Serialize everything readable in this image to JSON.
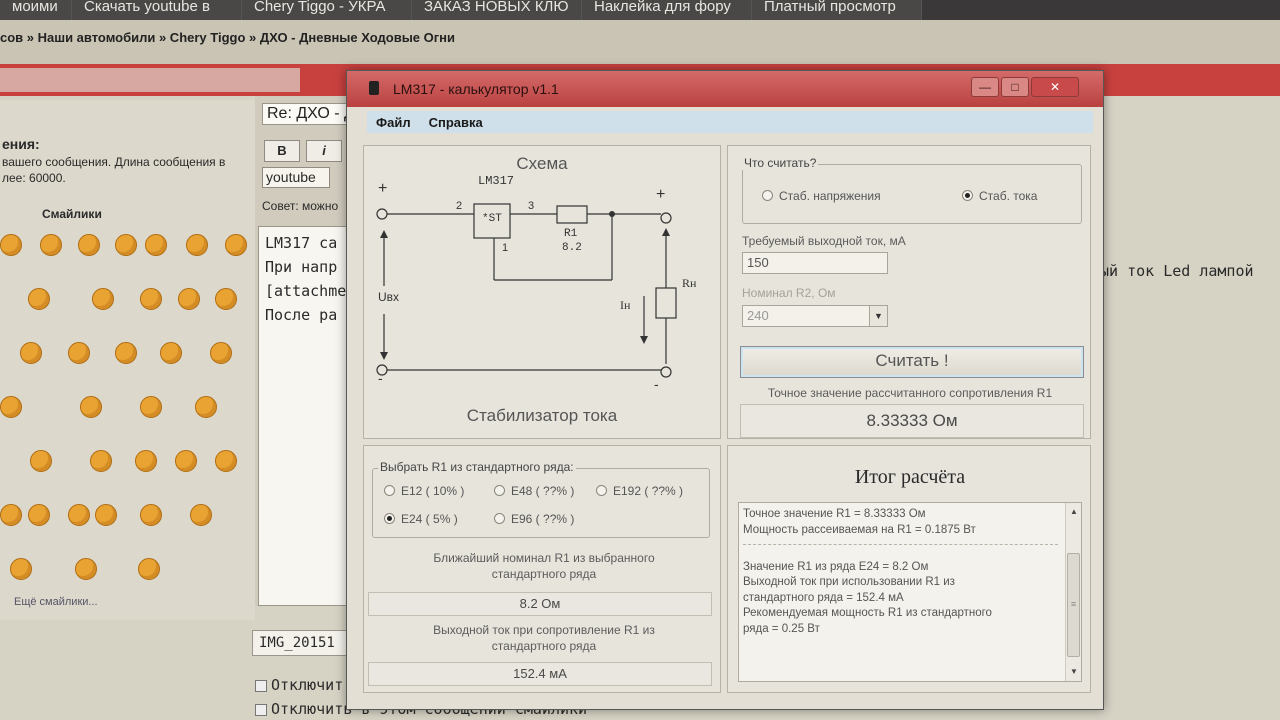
{
  "browser_tabs": [
    "моими",
    "Скачать youtube в",
    "Chery Tiggo - УКРА",
    "ЗАКАЗ НОВЫХ КЛЮ",
    "Наклейка для фору",
    "Платный просмотр"
  ],
  "forum": {
    "breadcrumb": "сов » Наши автомобили » Chery Tiggo » ДХО - Дневные Ходовые Огни",
    "subject": "Re: ДХО - Д",
    "message_title": "ения:",
    "message_hint": "вашего сообщения. Длина сообщения в лее: 60000.",
    "smilies_title": "Смайлики",
    "smilies_more": "Ещё смайлики...",
    "toolbar": {
      "bold": "B",
      "italic": "i",
      "youtube": "youtube"
    },
    "advice": "Совет: можно",
    "text_lines": [
      "LM317 са",
      "При напр",
      "[attachme",
      "После ра"
    ],
    "right_text": "ый ток Led лампой",
    "attachment": "IMG_20151",
    "checkbox1": "Отключит",
    "checkbox2": "Отключить в этом сообщении смайлики"
  },
  "window": {
    "title": "LM317 - калькулятор v1.1",
    "controls": {
      "minimize": "—",
      "maximize": "□",
      "close": "✕"
    },
    "menu": [
      "Файл",
      "Справка"
    ]
  },
  "scheme": {
    "title": "Схема",
    "caption": "Стабилизатор тока",
    "chip": "LM317",
    "chip_inner": "*ST",
    "pins": [
      "2",
      "3",
      "1"
    ],
    "resistor": "R1",
    "resistor_value": "8.2",
    "load": "Rн",
    "current": "Iн",
    "input": "Uвх",
    "plus": "+",
    "minus": "-"
  },
  "mode": {
    "label": "Что считать?",
    "options": [
      "Стаб. напряжения",
      "Стаб. тока"
    ],
    "selected": 1
  },
  "inputs": {
    "current_label": "Требуемый выходной ток, мА",
    "current_value": "150",
    "r2_label": "Номинал R2, Ом",
    "r2_value": "240"
  },
  "calculate_button": "Считать !",
  "exact": {
    "label": "Точное значение рассчитанного сопротивления R1",
    "value": "8.33333 Ом"
  },
  "series": {
    "label": "Выбрать R1 из стандартного ряда:",
    "options": [
      "E12 ( 10% )",
      "E48 ( ??% )",
      "E192 ( ??% )",
      "E24 ( 5% )",
      "E96 ( ??% )"
    ],
    "selected": "E24 ( 5% )",
    "nearest_label": "Ближайший номинал R1 из выбранного стандартного ряда",
    "nearest_value": "8.2 Ом",
    "output_label": "Выходной ток при сопротивление R1 из стандартного ряда",
    "output_value": "152.4 мА"
  },
  "result": {
    "title": "Итог расчёта",
    "block1": [
      "Точное значение R1 = 8.33333 Ом",
      "Мощность рассеиваемая на R1 = 0.1875 Вт"
    ],
    "block2": [
      "Значение R1 из ряда E24 = 8.2 Ом",
      "Выходной ток при использовании R1 из",
      "стандартного ряда = 152.4 мА",
      "Рекомендуемая мощность R1 из стандартного",
      "ряда = 0.25 Вт"
    ]
  },
  "colors": {
    "titlebar": "#c24a48",
    "menubar": "#cfe0ea",
    "button_glow": "#cde3ef"
  }
}
